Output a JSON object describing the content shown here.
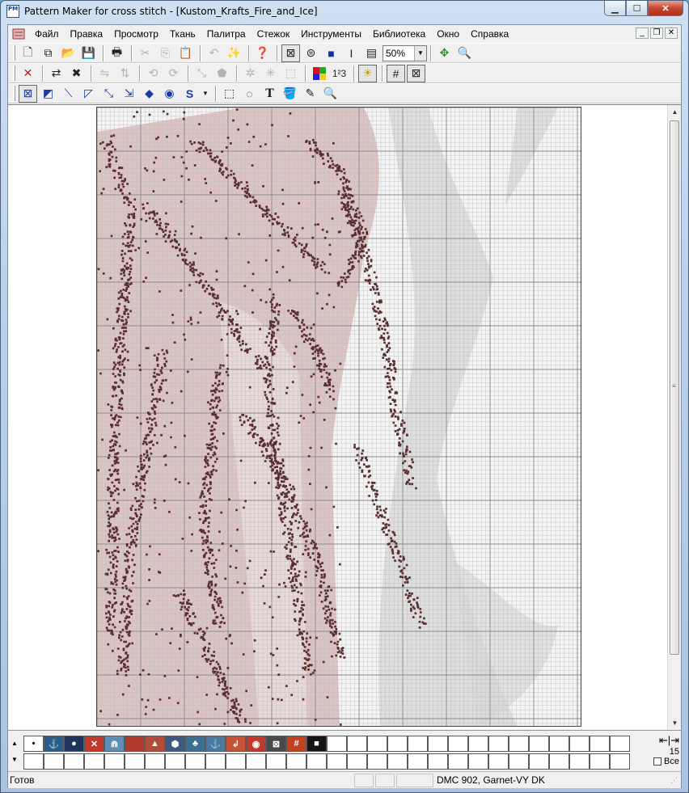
{
  "window": {
    "title": "Pattern Maker for cross stitch - [Kustom_Krafts_Fire_and_Ice]",
    "app_icon_text": "PM",
    "controls": [
      "minimize-icon",
      "maximize-icon",
      "close-icon"
    ]
  },
  "menu": {
    "items": [
      "Файл",
      "Правка",
      "Просмотр",
      "Ткань",
      "Палитра",
      "Стежок",
      "Инструменты",
      "Библиотека",
      "Окно",
      "Справка"
    ]
  },
  "toolbar1": {
    "zoom_value": "50%",
    "text_tool": "I"
  },
  "toolbar3": {
    "text_tool_label": "T",
    "stitch_s_label": "S"
  },
  "palette": {
    "colors": [
      "#ffffff",
      "#2a5d87",
      "#20355c",
      "#c0392b",
      "#5e8fb6",
      "#b03a2e",
      "#b44b3a",
      "#3d5a80",
      "#3b6f8f",
      "#4a78a0",
      "#c45236",
      "#c0392b",
      "#4a4a4a",
      "#c2411f",
      "#151515"
    ],
    "symbols": [
      "•",
      "⚓",
      "●",
      "✕",
      "⋒",
      "",
      "▲",
      "⬢",
      "♣",
      "⚓",
      "↲",
      "◉",
      "⊠",
      "#",
      "■"
    ],
    "page_number": "15",
    "all_label": "Все"
  },
  "status": {
    "left": "Готов",
    "thread": "DMC  902, Garnet-VY DK"
  },
  "colors": {
    "stitch_dark": "#5a2f2f",
    "fabric_pink": "#dcc4c4",
    "fabric_grey": "#d8d8d8"
  }
}
